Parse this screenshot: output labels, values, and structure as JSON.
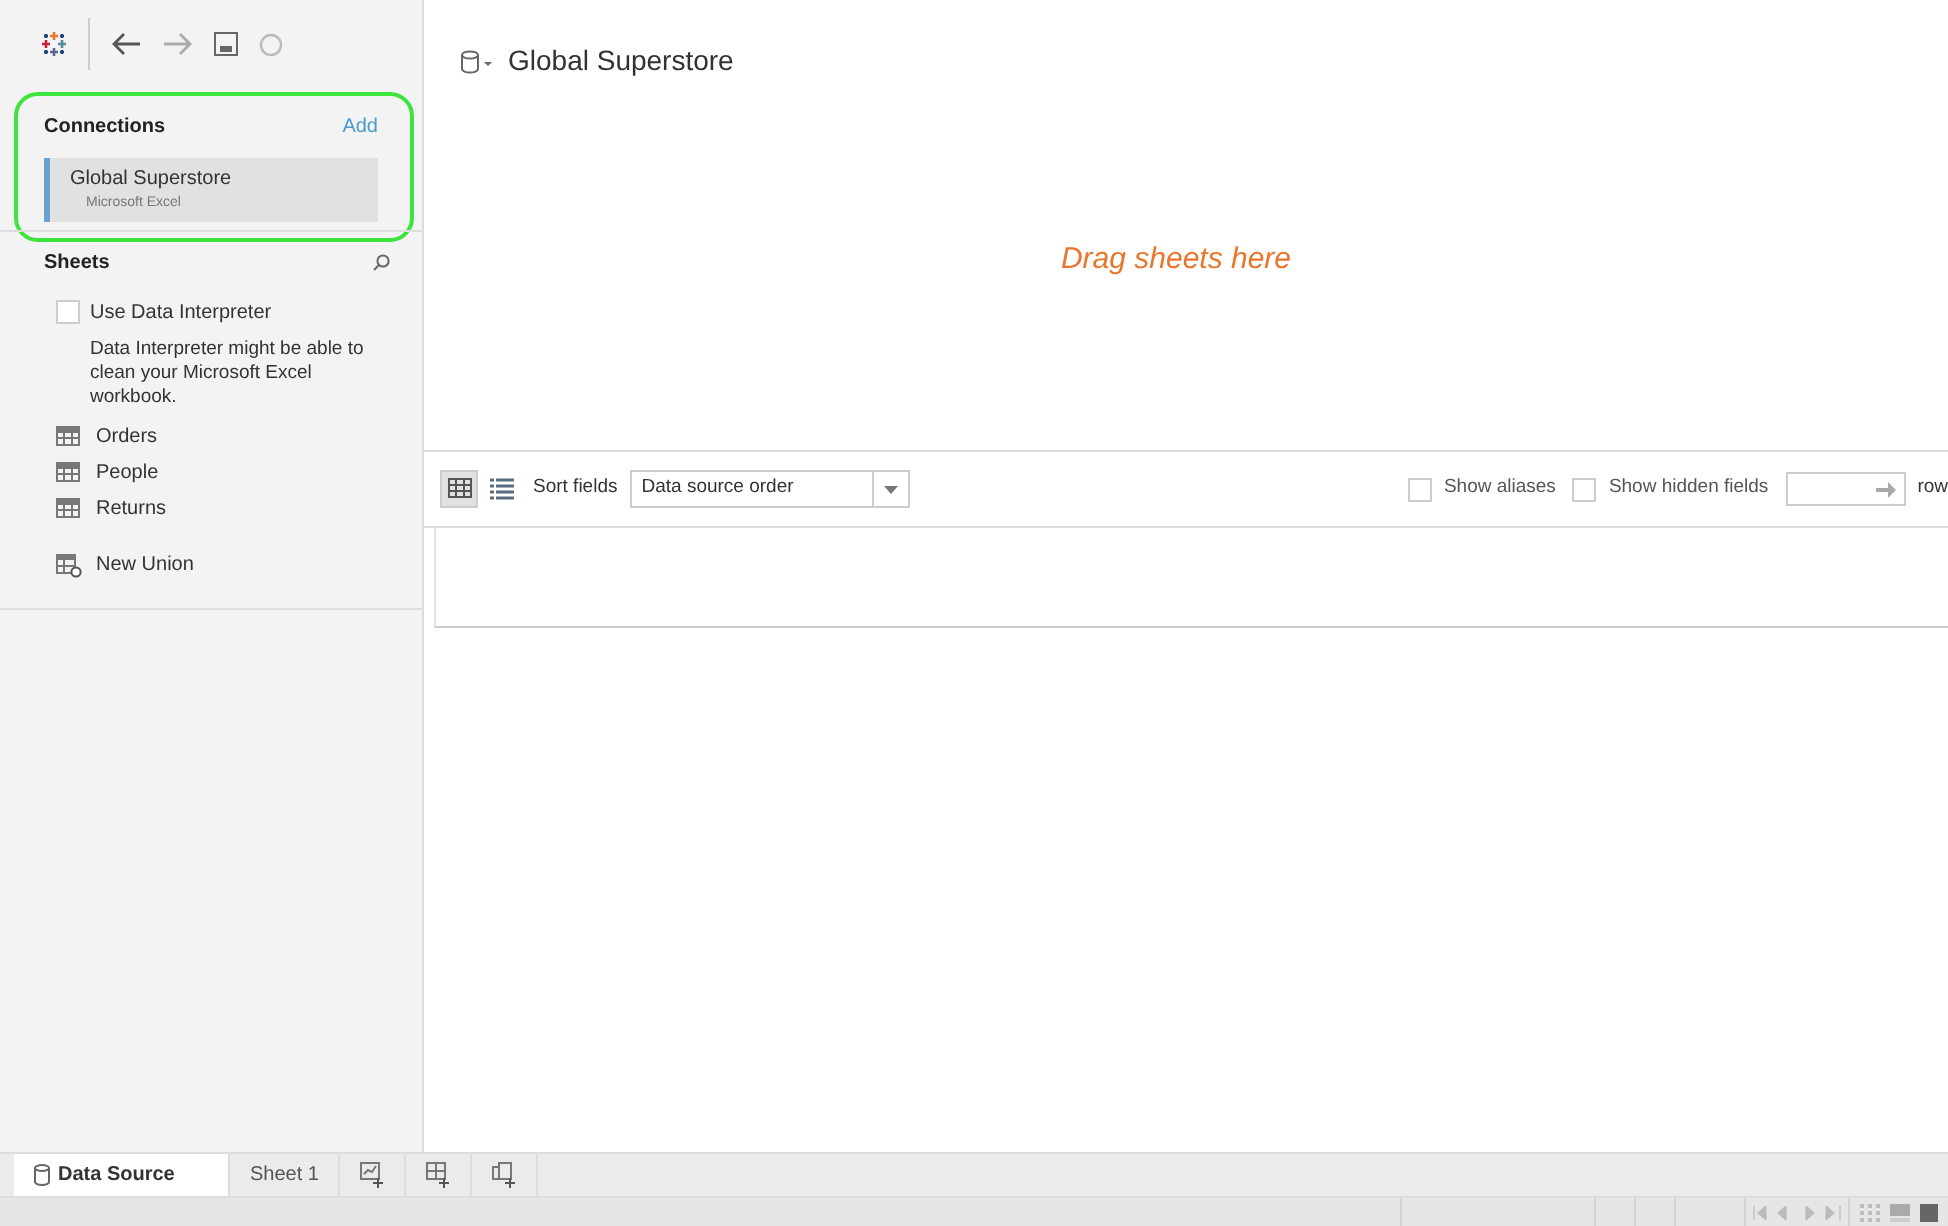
{
  "connections": {
    "title": "Connections",
    "add": "Add",
    "items": [
      {
        "name": "Global Superstore",
        "type": "Microsoft Excel",
        "selected": true
      }
    ]
  },
  "sheets": {
    "title": "Sheets",
    "interpreter": {
      "label": "Use Data Interpreter",
      "checked": false,
      "note": "Data Interpreter might be able to clean your Microsoft Excel workbook."
    },
    "items": [
      {
        "name": "Orders",
        "kind": "table"
      },
      {
        "name": "People",
        "kind": "table"
      },
      {
        "name": "Returns",
        "kind": "table"
      },
      {
        "name": "New Union",
        "kind": "union"
      }
    ]
  },
  "datasource": {
    "title": "Global Superstore"
  },
  "drop_hint": "Drag sheets here",
  "grid_toolbar": {
    "views": [
      {
        "kind": "grid",
        "selected": true
      },
      {
        "kind": "list",
        "selected": false
      }
    ],
    "sort_label": "Sort fields",
    "sort_value": "Data source order",
    "show_aliases": {
      "label": "Show aliases",
      "checked": false
    },
    "show_hidden": {
      "label": "Show hidden fields",
      "checked": false
    },
    "rows_label": "row"
  },
  "tabs": [
    {
      "label": "Data Source",
      "kind": "datasource",
      "selected": true
    },
    {
      "label": "Sheet 1",
      "kind": "sheet",
      "selected": false
    },
    {
      "kind": "new-sheet"
    },
    {
      "kind": "new-dashboard"
    },
    {
      "kind": "new-story"
    }
  ]
}
